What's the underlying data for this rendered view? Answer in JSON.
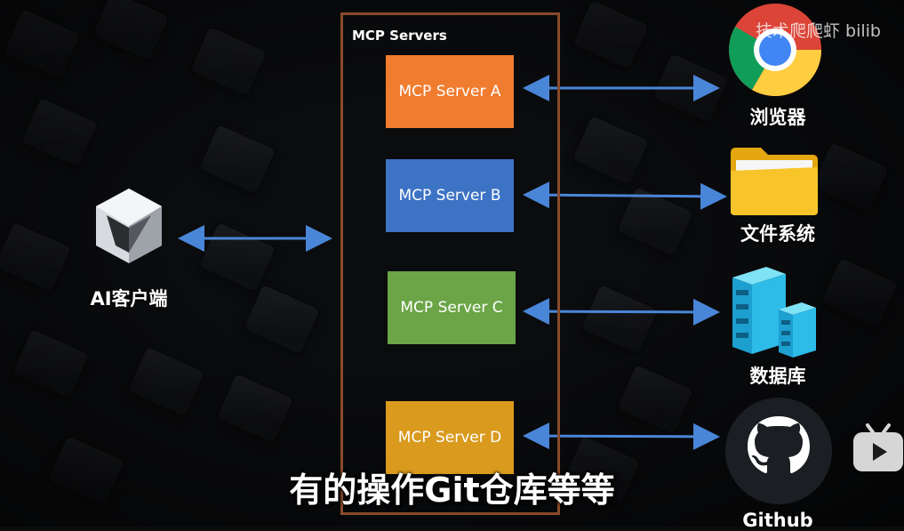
{
  "group": {
    "title": "MCP Servers"
  },
  "servers": [
    {
      "label": "MCP Server A"
    },
    {
      "label": "MCP Server B"
    },
    {
      "label": "MCP Server C"
    },
    {
      "label": "MCP Server D"
    }
  ],
  "client": {
    "label": "AI客户端",
    "icon": "ai-client-cube-icon"
  },
  "resources": [
    {
      "label": "浏览器",
      "icon": "chrome-icon"
    },
    {
      "label": "文件系统",
      "icon": "folder-icon"
    },
    {
      "label": "数据库",
      "icon": "database-server-icon"
    },
    {
      "label": "Github",
      "icon": "github-octocat-icon"
    }
  ],
  "watermark": "技术爬爬虾 bilib",
  "subtitle": "有的操作Git仓库等等",
  "colors": {
    "server_a": "#f07c2f",
    "server_b": "#3d73c4",
    "server_c": "#6ba547",
    "server_d": "#d99a1e",
    "arrow": "#4a86d8",
    "frame": "#8a4a2a"
  }
}
